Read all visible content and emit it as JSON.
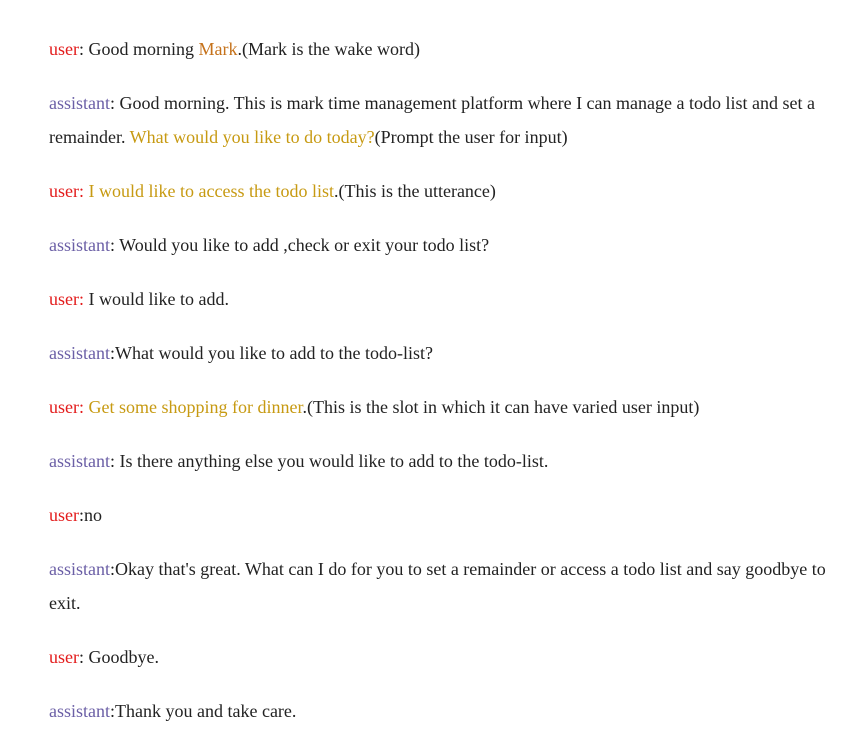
{
  "turns": [
    {
      "speaker": "user",
      "label": "user",
      "segments": [
        {
          "text": ": Good morning ",
          "style": "plain"
        },
        {
          "text": "Mark",
          "style": "orange"
        },
        {
          "text": ".(Mark is the wake word)",
          "style": "plain"
        }
      ]
    },
    {
      "speaker": "assistant",
      "label": "assistant",
      "segments": [
        {
          "text": ": Good morning. This is mark time management platform where I can manage a todo list and set a remainder. ",
          "style": "plain"
        },
        {
          "text": "What would you like to do today?",
          "style": "gold"
        },
        {
          "text": "(Prompt the user for input)",
          "style": "plain"
        }
      ]
    },
    {
      "speaker": "user",
      "label": "user",
      "segments": [
        {
          "text": ": ",
          "style": "plain-red"
        },
        {
          "text": "I would like to access the todo list",
          "style": "gold"
        },
        {
          "text": ".(This is the utterance)",
          "style": "plain"
        }
      ]
    },
    {
      "speaker": "assistant",
      "label": "assistant",
      "segments": [
        {
          "text": ": Would you like to add ,check or exit your todo list?",
          "style": "plain"
        }
      ]
    },
    {
      "speaker": "user",
      "label": "user",
      "segments": [
        {
          "text": ": ",
          "style": "plain-red"
        },
        {
          "text": "I would like to add.",
          "style": "plain"
        }
      ]
    },
    {
      "speaker": "assistant",
      "label": "assistant",
      "segments": [
        {
          "text": ":What would you like to add to the todo-list?",
          "style": "plain"
        }
      ]
    },
    {
      "speaker": "user",
      "label": "user",
      "segments": [
        {
          "text": ": ",
          "style": "plain-red"
        },
        {
          "text": "Get some shopping for dinner",
          "style": "gold"
        },
        {
          "text": ".(This is the slot in which it can have varied user input)",
          "style": "plain"
        }
      ]
    },
    {
      "speaker": "assistant",
      "label": "assistant",
      "segments": [
        {
          "text": ": Is there anything else you would like to add to the todo-list.",
          "style": "plain"
        }
      ]
    },
    {
      "speaker": "user",
      "label": "user",
      "segments": [
        {
          "text": ":no",
          "style": "plain"
        }
      ]
    },
    {
      "speaker": "assistant",
      "label": "assistant",
      "segments": [
        {
          "text": ":Okay that's great. What can I do for you to set a remainder or access a todo list and say goodbye to exit.",
          "style": "plain"
        }
      ]
    },
    {
      "speaker": "user",
      "label": "user",
      "segments": [
        {
          "text": ": Goodbye.",
          "style": "plain"
        }
      ]
    },
    {
      "speaker": "assistant",
      "label": "assistant",
      "segments": [
        {
          "text": ":Thank you and take care.",
          "style": "plain"
        }
      ]
    }
  ],
  "colors": {
    "user": "#e31b1b",
    "assistant": "#6b5fa6",
    "orange": "#c5721b",
    "gold": "#c79a12",
    "text": "#222222"
  }
}
